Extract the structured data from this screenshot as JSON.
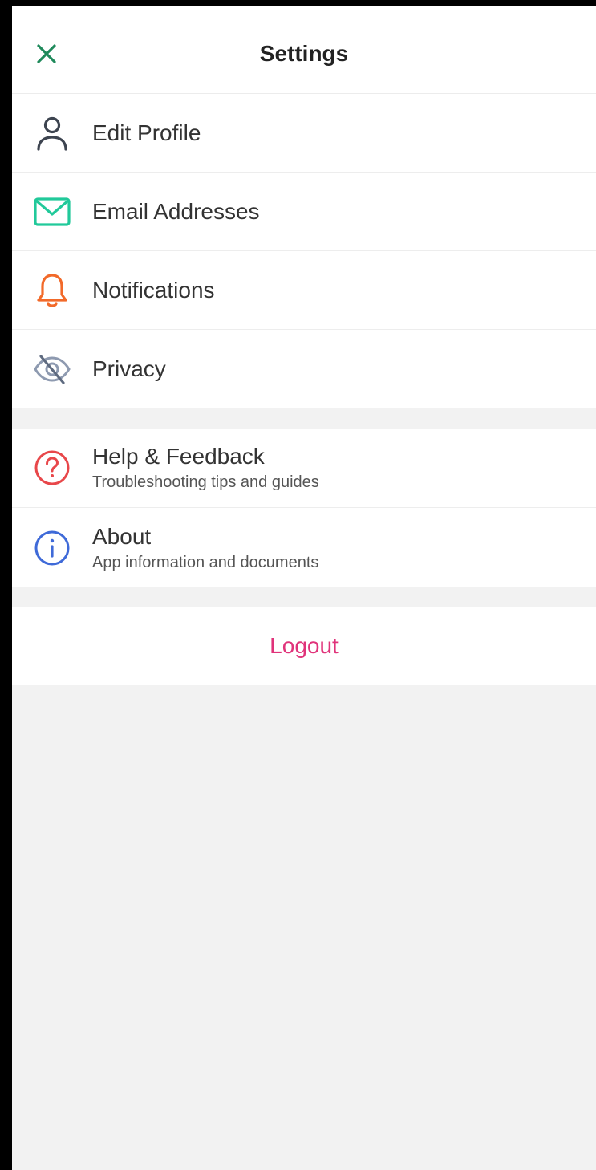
{
  "header": {
    "title": "Settings"
  },
  "menu_primary": [
    {
      "label": "Edit Profile",
      "icon": "person-icon",
      "color": "#3d4450"
    },
    {
      "label": "Email Addresses",
      "icon": "envelope-icon",
      "color": "#21c99a"
    },
    {
      "label": "Notifications",
      "icon": "bell-icon",
      "color": "#f26a2a"
    },
    {
      "label": "Privacy",
      "icon": "eye-off-icon",
      "color": "#8e9ab0"
    }
  ],
  "menu_secondary": [
    {
      "label": "Help & Feedback",
      "sub": "Troubleshooting tips and guides",
      "icon": "help-circle-icon",
      "color": "#e8474a"
    },
    {
      "label": "About",
      "sub": "App information and documents",
      "icon": "info-circle-icon",
      "color": "#3f6ad8"
    }
  ],
  "logout": {
    "label": "Logout",
    "color": "#e0337a"
  },
  "colors": {
    "close_icon": "#1f8a5b",
    "background": "#f2f2f2",
    "row_background": "#ffffff"
  }
}
